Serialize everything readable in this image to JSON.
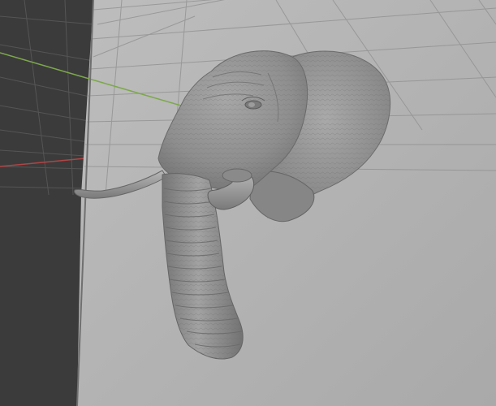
{
  "viewport": {
    "background_color": "#3a3a3a",
    "wall_color": "#b4b4b4",
    "grid_color": "#8a8a8a",
    "x_axis_color": "#c04848",
    "y_axis_color": "#7fb04a",
    "model_color": "#8f8f8f"
  },
  "scene": {
    "object": "elephant-head-sculpt",
    "shading": "solid"
  }
}
